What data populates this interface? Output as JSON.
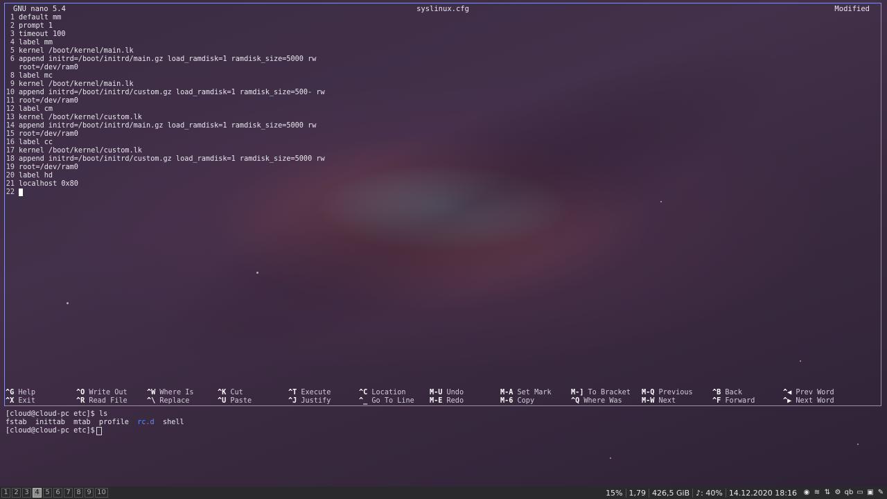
{
  "nano": {
    "app_title": "GNU nano 5.4",
    "file_name": "syslinux.cfg",
    "state": "Modified",
    "lines": [
      {
        "n": "1",
        "text": "default mm"
      },
      {
        "n": "2",
        "text": "prompt 1"
      },
      {
        "n": "3",
        "text": "timeout 100"
      },
      {
        "n": "4",
        "text": "label mm"
      },
      {
        "n": "5",
        "text": "kernel /boot/kernel/main.lk"
      },
      {
        "n": "6",
        "text": "append initrd=/boot/initrd/main.gz load_ramdisk=1 ramdisk_size=5000 rw"
      },
      {
        "n": "",
        "text": "root=/dev/ram0"
      },
      {
        "n": "8",
        "text": "label mc"
      },
      {
        "n": "9",
        "text": "kernel /boot/kernel/main.lk"
      },
      {
        "n": "10",
        "text": "append initrd=/boot/initrd/custom.gz load_ramdisk=1 ramdisk_size=500- rw"
      },
      {
        "n": "11",
        "text": "root=/dev/ram0"
      },
      {
        "n": "12",
        "text": "label cm"
      },
      {
        "n": "13",
        "text": "kernel /boot/kernel/custom.lk"
      },
      {
        "n": "14",
        "text": "append initrd=/boot/initrd/main.gz load_ramdisk=1 ramdisk_size=5000 rw"
      },
      {
        "n": "15",
        "text": "root=/dev/ram0"
      },
      {
        "n": "16",
        "text": "label cc"
      },
      {
        "n": "17",
        "text": "kernel /boot/kernel/custom.lk"
      },
      {
        "n": "18",
        "text": "append initrd=/boot/initrd/custom.gz load_ramdisk=1 ramdisk_size=5000 rw"
      },
      {
        "n": "19",
        "text": "root=/dev/ram0"
      },
      {
        "n": "20",
        "text": "label hd"
      },
      {
        "n": "21",
        "text": "localhost 0x80"
      },
      {
        "n": "22",
        "text": ""
      }
    ],
    "shortcuts_row1": [
      {
        "key": "^G",
        "label": "Help"
      },
      {
        "key": "^O",
        "label": "Write Out"
      },
      {
        "key": "^W",
        "label": "Where Is"
      },
      {
        "key": "^K",
        "label": "Cut"
      },
      {
        "key": "^T",
        "label": "Execute"
      },
      {
        "key": "^C",
        "label": "Location"
      },
      {
        "key": "M-U",
        "label": "Undo"
      },
      {
        "key": "M-A",
        "label": "Set Mark"
      },
      {
        "key": "M-]",
        "label": "To Bracket"
      },
      {
        "key": "M-Q",
        "label": "Previous"
      },
      {
        "key": "^B",
        "label": "Back"
      },
      {
        "key": "^◀",
        "label": "Prev Word"
      }
    ],
    "shortcuts_row2": [
      {
        "key": "^X",
        "label": "Exit"
      },
      {
        "key": "^R",
        "label": "Read File"
      },
      {
        "key": "^\\",
        "label": "Replace"
      },
      {
        "key": "^U",
        "label": "Paste"
      },
      {
        "key": "^J",
        "label": "Justify"
      },
      {
        "key": "^_",
        "label": "Go To Line"
      },
      {
        "key": "M-E",
        "label": "Redo"
      },
      {
        "key": "M-6",
        "label": "Copy"
      },
      {
        "key": "^Q",
        "label": "Where Was"
      },
      {
        "key": "M-W",
        "label": "Next"
      },
      {
        "key": "^F",
        "label": "Forward"
      },
      {
        "key": "^▶",
        "label": "Next Word"
      }
    ]
  },
  "terminal": {
    "prompt": "[cloud@cloud-pc etc]$",
    "command": "ls",
    "listing_pre": "fstab  inittab  mtab  profile  ",
    "listing_dir": "rc.d",
    "listing_post": "  shell"
  },
  "bar": {
    "workspaces": [
      "1",
      "2",
      "3",
      "4",
      "5",
      "6",
      "7",
      "8",
      "9",
      "10"
    ],
    "active_workspace": "4",
    "status": [
      "15%",
      "1,79",
      "426,5 GiB",
      "♪: 40%",
      "14.12.2020 18:16"
    ],
    "tray_icons": [
      "discord-icon",
      "wifi-icon",
      "updown-arrows-icon",
      "gear-icon",
      "qb",
      "battery-icon",
      "image-icon",
      "pen-icon"
    ]
  },
  "colors": {
    "dir_blue": "#5c8cff",
    "nano_border": "#8a8fd6",
    "bar_bg": "#2a2a2d"
  }
}
